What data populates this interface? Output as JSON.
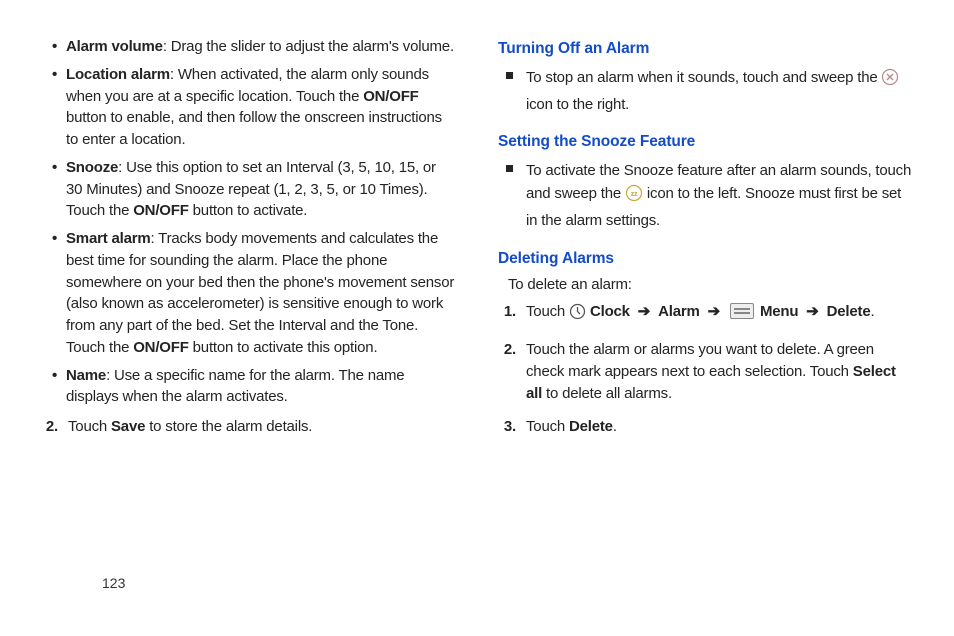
{
  "col1": {
    "bullets": [
      {
        "term": "Alarm volume",
        "desc": ": Drag the slider to adjust the alarm's volume."
      },
      {
        "term": "Location alarm",
        "desc_pre": ": When activated, the alarm only sounds when you are at a specific location. Touch the ",
        "bold1": "ON/OFF",
        "desc_post": " button to enable, and then follow the onscreen instructions to enter a location."
      },
      {
        "term": "Snooze",
        "desc_pre": ": Use this option to set an Interval (3, 5, 10, 15, or 30 Minutes) and Snooze repeat (1, 2, 3, 5, or 10 Times). Touch the ",
        "bold1": "ON/OFF",
        "desc_post": " button to activate."
      },
      {
        "term": "Smart alarm",
        "desc_pre": ": Tracks body movements and calculates the best time for sounding the alarm. Place the phone somewhere on your bed then the phone's movement sensor  (also known as accelerometer) is sensitive enough to work from any part of the bed. Set the Interval and the Tone. Touch the ",
        "bold1": "ON/OFF",
        "desc_post": " button to activate this option."
      },
      {
        "term": "Name",
        "desc": ": Use a specific name for the alarm. The name displays when the alarm activates."
      }
    ],
    "step2_num": "2.",
    "step2_pre": "Touch ",
    "step2_bold": "Save",
    "step2_post": " to store the alarm details."
  },
  "col2": {
    "h_off": "Turning Off an Alarm",
    "off_pre": "To stop an alarm when it sounds, touch and sweep the ",
    "off_post": " icon to the right.",
    "h_snooze": "Setting the Snooze Feature",
    "snooze_pre": "To activate the Snooze feature after an alarm sounds, touch and sweep the ",
    "snooze_post": " icon to the left. Snooze must first be set in the alarm settings.",
    "h_del": "Deleting Alarms",
    "del_sub": "To delete an alarm:",
    "s1_num": "1.",
    "s1_touch": "Touch ",
    "s1_clock": "Clock",
    "s1_alarm": "Alarm",
    "s1_menu": "Menu",
    "s1_delete": "Delete",
    "s1_dot": ".",
    "s2_num": "2.",
    "s2_pre": "Touch the alarm or alarms you want to delete. A green check mark appears next to each selection. Touch ",
    "s2_bold": "Select all",
    "s2_post": " to delete all alarms.",
    "s3_num": "3.",
    "s3_pre": "Touch ",
    "s3_bold": "Delete",
    "s3_post": "."
  },
  "page_number": "123",
  "arrow": "➔"
}
